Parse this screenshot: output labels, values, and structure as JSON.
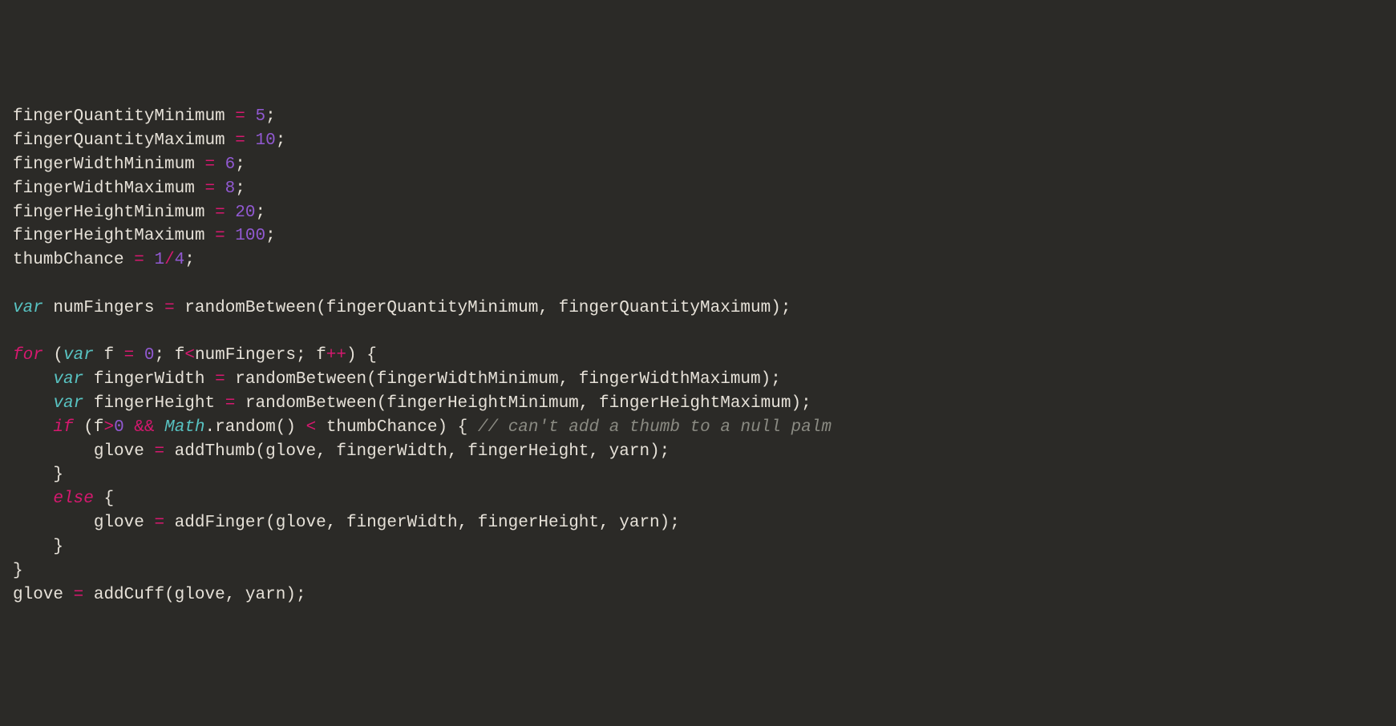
{
  "colors": {
    "background": "#2b2a27",
    "foreground": "#e6e1d8",
    "keyword": "#d6186f",
    "declaration": "#58c3c2",
    "number": "#9159d1",
    "comment": "#8a8a82",
    "builtin": "#58c3c2"
  },
  "code": {
    "l1": {
      "name": "fingerQuantityMinimum",
      "eq": "=",
      "val": "5",
      "semi": ";"
    },
    "l2": {
      "name": "fingerQuantityMaximum",
      "eq": "=",
      "val": "10",
      "semi": ";"
    },
    "l3": {
      "name": "fingerWidthMinimum",
      "eq": "=",
      "val": "6",
      "semi": ";"
    },
    "l4": {
      "name": "fingerWidthMaximum",
      "eq": "=",
      "val": "8",
      "semi": ";"
    },
    "l5": {
      "name": "fingerHeightMinimum",
      "eq": "=",
      "val": "20",
      "semi": ";"
    },
    "l6": {
      "name": "fingerHeightMaximum",
      "eq": "=",
      "val": "100",
      "semi": ";"
    },
    "l7": {
      "name": "thumbChance",
      "eq": "=",
      "n1": "1",
      "slash": "/",
      "n2": "4",
      "semi": ";"
    },
    "l9": {
      "kw": "var",
      "name": "numFingers",
      "eq": "=",
      "fn": "randomBetween",
      "lp": "(",
      "a1": "fingerQuantityMinimum",
      "c": ",",
      "a2": "fingerQuantityMaximum",
      "rp": ")",
      "semi": ";"
    },
    "l11": {
      "for": "for",
      "lp": "(",
      "kw": "var",
      "f": "f",
      "eq": "=",
      "zero": "0",
      "semi": ";",
      "f2": "f",
      "lt": "<",
      "nf": "numFingers",
      "semi2": ";",
      "f3": "f",
      "pp": "++",
      "rp": ")",
      "lb": "{"
    },
    "l12": {
      "kw": "var",
      "name": "fingerWidth",
      "eq": "=",
      "fn": "randomBetween",
      "lp": "(",
      "a1": "fingerWidthMinimum",
      "c": ",",
      "a2": "fingerWidthMaximum",
      "rp": ")",
      "semi": ";"
    },
    "l13": {
      "kw": "var",
      "name": "fingerHeight",
      "eq": "=",
      "fn": "randomBetween",
      "lp": "(",
      "a1": "fingerHeightMinimum",
      "c": ",",
      "a2": "fingerHeightMaximum",
      "rp": ")",
      "semi": ";"
    },
    "l14": {
      "if": "if",
      "lp": "(",
      "f": "f",
      "gt": ">",
      "zero": "0",
      "and": "&&",
      "math": "Math",
      "dot": ".",
      "rand": "random",
      "lp2": "(",
      "rp2": ")",
      "lt": "<",
      "tc": "thumbChance",
      "rp": ")",
      "lb": "{",
      "comment": "// can't add a thumb to a null palm"
    },
    "l15": {
      "glove": "glove",
      "eq": "=",
      "fn": "addThumb",
      "lp": "(",
      "a1": "glove",
      "c1": ",",
      "a2": "fingerWidth",
      "c2": ",",
      "a3": "fingerHeight",
      "c3": ",",
      "a4": "yarn",
      "rp": ")",
      "semi": ";"
    },
    "l16": {
      "rb": "}"
    },
    "l17": {
      "else": "else",
      "lb": "{"
    },
    "l18": {
      "glove": "glove",
      "eq": "=",
      "fn": "addFinger",
      "lp": "(",
      "a1": "glove",
      "c1": ",",
      "a2": "fingerWidth",
      "c2": ",",
      "a3": "fingerHeight",
      "c3": ",",
      "a4": "yarn",
      "rp": ")",
      "semi": ";"
    },
    "l19": {
      "rb": "}"
    },
    "l20": {
      "rb": "}"
    },
    "l21": {
      "glove": "glove",
      "eq": "=",
      "fn": "addCuff",
      "lp": "(",
      "a1": "glove",
      "c": ",",
      "a2": "yarn",
      "rp": ")",
      "semi": ";"
    }
  }
}
